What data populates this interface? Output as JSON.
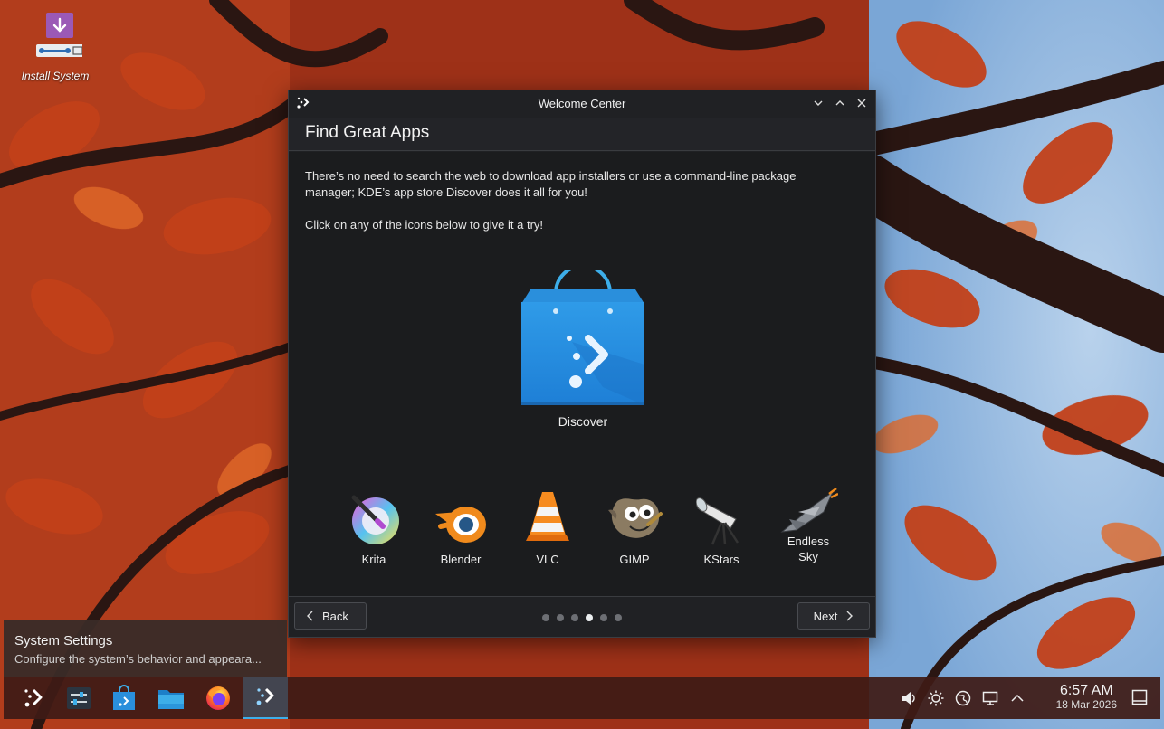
{
  "desktop": {
    "icons": [
      {
        "label": "Install System",
        "icon": "install-system-icon"
      }
    ]
  },
  "window": {
    "title": "Welcome Center",
    "page_title": "Find Great Apps",
    "description_1": "There’s no need to search the web to download app installers or use a command-line package manager; KDE’s app store Discover does it all for you!",
    "description_2": "Click on any of the icons below to give it a try!",
    "featured_app": {
      "name": "Discover",
      "icon": "discover-bag-icon"
    },
    "apps": [
      {
        "name": "Krita",
        "icon": "krita-icon"
      },
      {
        "name": "Blender",
        "icon": "blender-icon"
      },
      {
        "name": "VLC",
        "icon": "vlc-cone-icon"
      },
      {
        "name": "GIMP",
        "icon": "gimp-icon"
      },
      {
        "name": "KStars",
        "icon": "telescope-icon"
      },
      {
        "name": "Endless Sky",
        "icon": "spaceship-icon"
      }
    ],
    "back_label": "Back",
    "next_label": "Next",
    "page_count": 6,
    "current_page": 4
  },
  "tooltip": {
    "title": "System Settings",
    "subtitle": "Configure the system’s behavior and appeara..."
  },
  "taskbar": {
    "items": [
      {
        "name": "application-launcher",
        "icon": "kde-launcher-icon"
      },
      {
        "name": "system-settings",
        "icon": "settings-icon"
      },
      {
        "name": "discover",
        "icon": "discover-icon"
      },
      {
        "name": "dolphin",
        "icon": "folder-icon"
      },
      {
        "name": "firefox",
        "icon": "firefox-icon"
      },
      {
        "name": "welcome-center",
        "icon": "welcome-center-icon",
        "active": true
      }
    ],
    "tray": [
      "volume-icon",
      "brightness-icon",
      "network-icon",
      "display-icon",
      "expand-tray-icon"
    ],
    "time": "6:57 AM",
    "date": "18 Mar 2026"
  },
  "colors": {
    "accent": "#3daee9",
    "window_bg": "#1b1c1e",
    "taskbar_bg": "#3e1b16"
  }
}
